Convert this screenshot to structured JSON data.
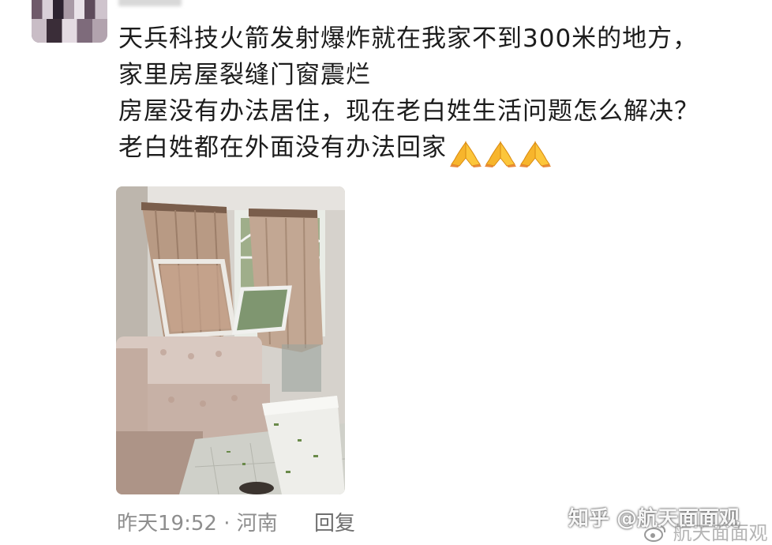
{
  "post": {
    "lines": [
      "天兵科技火箭发射爆炸就在我家不到300米的地方，",
      "家里房屋裂缝门窗震烂",
      "房屋没有办法居住，现在老白姓生活问题怎么解决？",
      "老白姓都在外面没有办法回家"
    ],
    "emoji": [
      "folded-hands",
      "folded-hands",
      "folded-hands"
    ]
  },
  "footer": {
    "time_location": "昨天19:52 · 河南",
    "reply_label": "回复"
  },
  "watermark": {
    "text": "知乎 @航天面面观",
    "text2": "航天面面观"
  },
  "colors": {
    "text": "#1c1c1c",
    "meta": "#8e8e8e",
    "background": "#ffffff"
  }
}
